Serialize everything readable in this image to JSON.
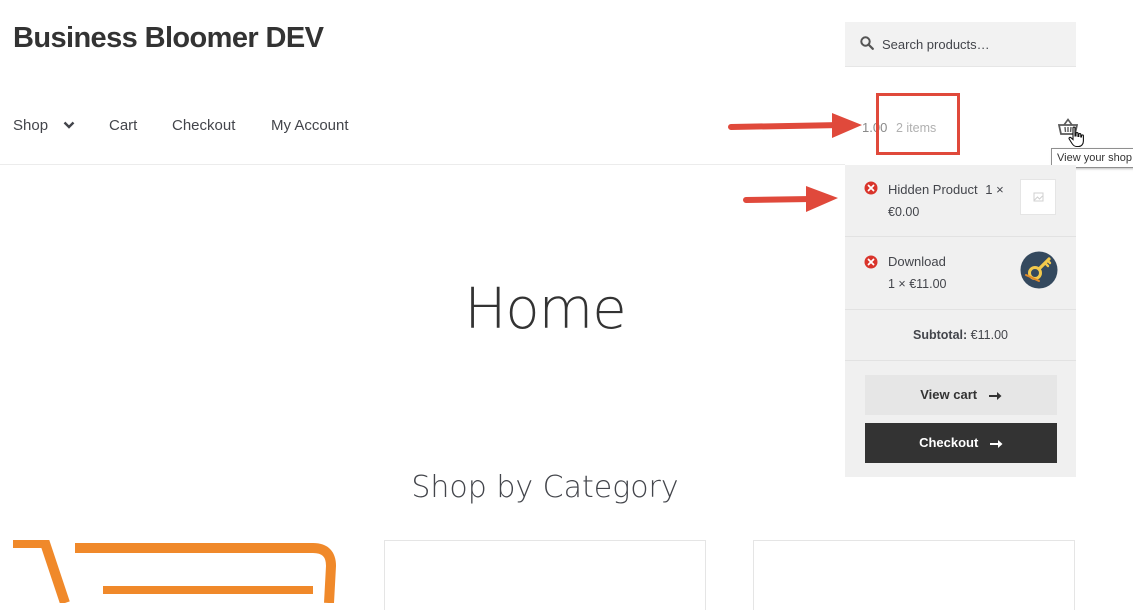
{
  "site": {
    "title": "Business Bloomer DEV"
  },
  "search": {
    "placeholder": "Search products…",
    "icon": "search-icon"
  },
  "nav": {
    "items": [
      {
        "label": "Shop",
        "has_dropdown": true
      },
      {
        "label": "Cart"
      },
      {
        "label": "Checkout"
      },
      {
        "label": "My Account"
      }
    ]
  },
  "cart_link": {
    "total": "1.00",
    "count": "2 items",
    "tooltip": "View your shop"
  },
  "mini_cart": {
    "items": [
      {
        "name": "Hidden Product",
        "qty": "1 ×",
        "price": "€0.00"
      },
      {
        "name": "Download",
        "line2": "1 × €11.00"
      }
    ],
    "subtotal_label": "Subtotal:",
    "subtotal_value": "€11.00",
    "view_cart_label": "View cart",
    "checkout_label": "Checkout"
  },
  "main": {
    "title": "Home",
    "section_title": "Shop by Category"
  },
  "colors": {
    "accent_red": "#e0493b",
    "dark_button": "#333333",
    "orange": "#f0892a"
  }
}
